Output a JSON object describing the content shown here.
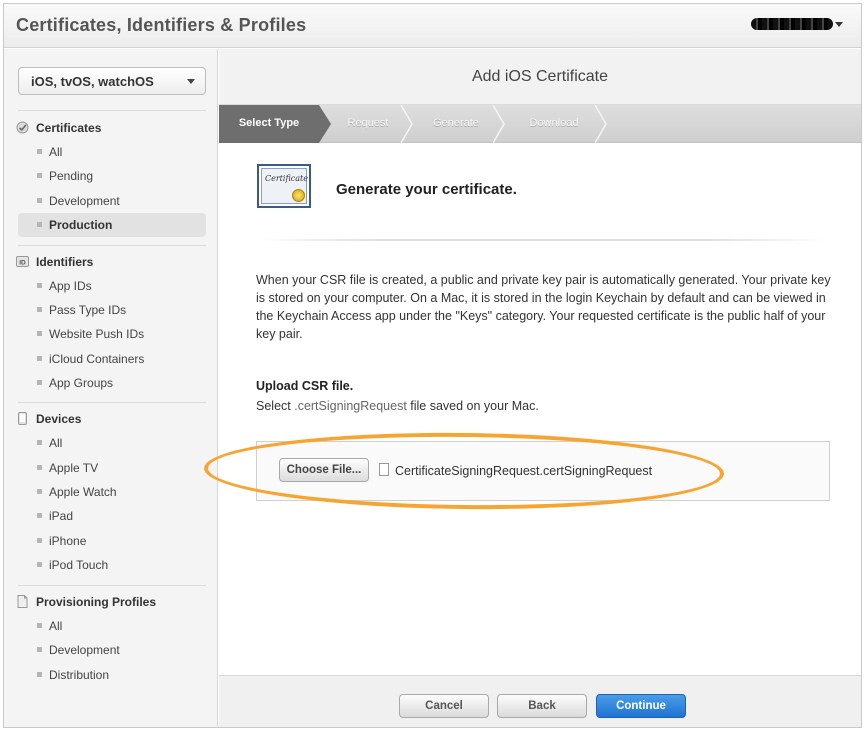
{
  "app": {
    "title": "Certificates, Identifiers & Profiles"
  },
  "sidebar": {
    "platform": "iOS, tvOS, watchOS",
    "sections": [
      {
        "label": "Certificates",
        "icon": "certificate-icon",
        "items": [
          "All",
          "Pending",
          "Development",
          "Production"
        ]
      },
      {
        "label": "Identifiers",
        "icon": "id-icon",
        "items": [
          "App IDs",
          "Pass Type IDs",
          "Website Push IDs",
          "iCloud Containers",
          "App Groups"
        ]
      },
      {
        "label": "Devices",
        "icon": "device-icon",
        "items": [
          "All",
          "Apple TV",
          "Apple Watch",
          "iPad",
          "iPhone",
          "iPod Touch"
        ]
      },
      {
        "label": "Provisioning Profiles",
        "icon": "profile-icon",
        "items": [
          "All",
          "Development",
          "Distribution"
        ]
      }
    ],
    "selected": "Production",
    "id_badge": "ID"
  },
  "main": {
    "title": "Add iOS Certificate",
    "steps": [
      "Select Type",
      "Request",
      "Generate",
      "Download"
    ],
    "active_step": "Select Type",
    "cert_icon_text": "Certificate",
    "heading": "Generate your certificate.",
    "paragraph": "When your CSR file is created, a public and private key pair is automatically generated. Your private key is stored on your computer. On a Mac, it is stored in the login Keychain by default and can be viewed in the Keychain Access app under the \"Keys\" category. Your requested certificate is the public half of your key pair.",
    "upload_title": "Upload CSR file.",
    "upload_sub_prefix": "Select ",
    "upload_sub_code": ".certSigningRequest",
    "upload_sub_suffix": " file saved on your Mac.",
    "choose_label": "Choose File...",
    "file_name": "CertificateSigningRequest.certSigningRequest"
  },
  "footer": {
    "cancel": "Cancel",
    "back": "Back",
    "continue": "Continue"
  },
  "colors": {
    "accent": "#1f73d1",
    "highlight": "#f7a532",
    "step_active": "#6e6e6e"
  }
}
